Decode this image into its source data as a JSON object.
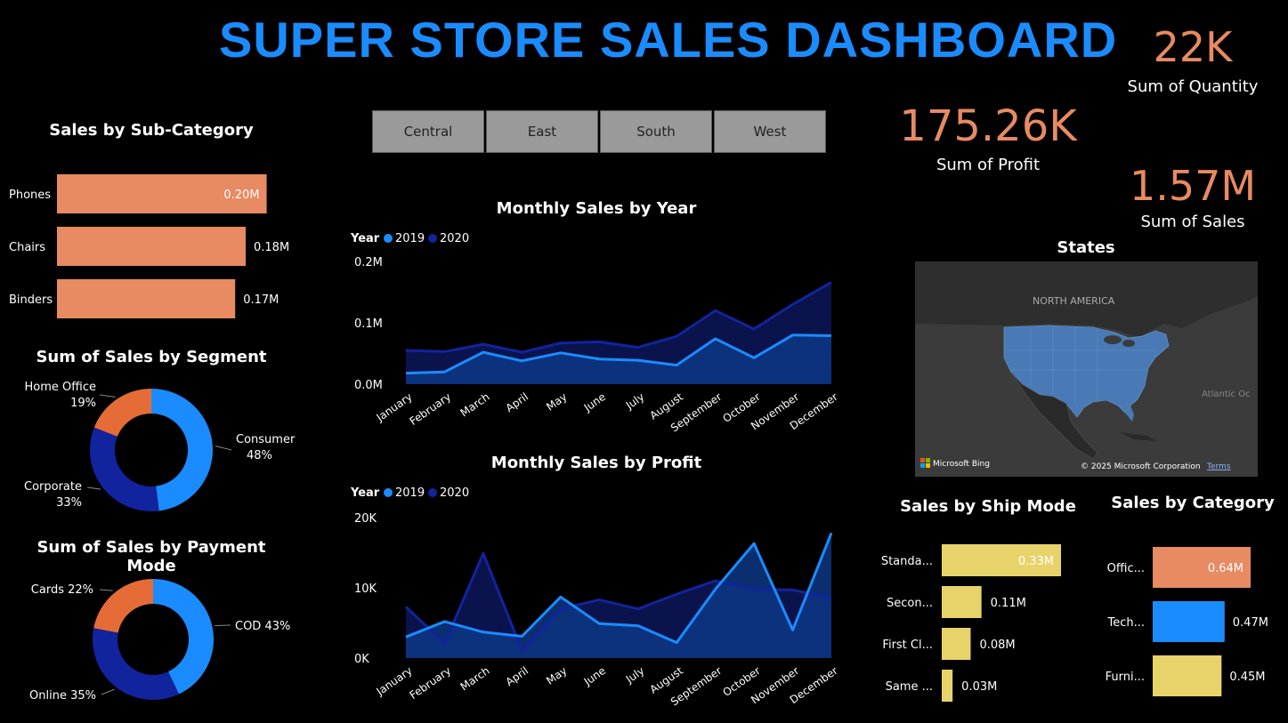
{
  "title": "SUPER STORE SALES DASHBOARD",
  "cards": {
    "quantity": {
      "value": "22K",
      "label": "Sum of Quantity"
    },
    "profit": {
      "value": "175.26K",
      "label": "Sum of Profit"
    },
    "sales": {
      "value": "1.57M",
      "label": "Sum of Sales"
    }
  },
  "slicer": {
    "regions": [
      "Central",
      "East",
      "South",
      "West"
    ]
  },
  "subcategory": {
    "title": "Sales by Sub-Category",
    "chart_data": {
      "type": "bar",
      "categories": [
        "Phones",
        "Chairs",
        "Binders"
      ],
      "values": [
        0.2,
        0.18,
        0.17
      ],
      "labels": [
        "0.20M",
        "0.18M",
        "0.17M"
      ],
      "color": "#e88a62"
    }
  },
  "segment": {
    "title": "Sum of Sales by Segment",
    "chart_data": {
      "type": "pie",
      "categories": [
        "Consumer",
        "Corporate",
        "Home Office"
      ],
      "values": [
        48,
        33,
        19
      ],
      "colors": [
        "#1a8cff",
        "#12239e",
        "#e66c37"
      ],
      "labels": [
        [
          "Consumer",
          "48%"
        ],
        [
          "Corporate",
          "33%"
        ],
        [
          "Home Office",
          "19%"
        ]
      ]
    }
  },
  "payment": {
    "title": "Sum of Sales by Payment Mode",
    "chart_data": {
      "type": "pie",
      "categories": [
        "COD",
        "Online",
        "Cards"
      ],
      "values": [
        43,
        35,
        22
      ],
      "colors": [
        "#1a8cff",
        "#12239e",
        "#e66c37"
      ],
      "labels": [
        "COD 43%",
        "Online 35%",
        "Cards 22%"
      ]
    }
  },
  "monthly_sales": {
    "title": "Monthly Sales by Year",
    "legend_title": "Year",
    "chart_data": {
      "type": "area",
      "x": [
        "January",
        "February",
        "March",
        "April",
        "May",
        "June",
        "July",
        "August",
        "September",
        "October",
        "November",
        "December"
      ],
      "series": [
        {
          "name": "2019",
          "color": "#1a8cff",
          "values": [
            0.018,
            0.02,
            0.052,
            0.038,
            0.051,
            0.041,
            0.039,
            0.031,
            0.074,
            0.043,
            0.08,
            0.079
          ]
        },
        {
          "name": "2020",
          "color": "#12239e",
          "values": [
            0.055,
            0.053,
            0.065,
            0.052,
            0.067,
            0.069,
            0.06,
            0.078,
            0.12,
            0.09,
            0.13,
            0.166
          ]
        }
      ],
      "ylim": [
        0,
        0.2
      ],
      "yticks": [
        "0.0M",
        "0.1M",
        "0.2M"
      ],
      "ytick_values": [
        0,
        0.1,
        0.2
      ]
    }
  },
  "monthly_profit": {
    "title": "Monthly Sales by Profit",
    "legend_title": "Year",
    "chart_data": {
      "type": "area",
      "x": [
        "January",
        "February",
        "March",
        "April",
        "May",
        "June",
        "July",
        "August",
        "September",
        "October",
        "November",
        "December"
      ],
      "series": [
        {
          "name": "2019",
          "color": "#1a8cff",
          "values": [
            3000,
            5200,
            3700,
            3100,
            8700,
            4900,
            4600,
            2200,
            9800,
            16300,
            4000,
            17800
          ]
        },
        {
          "name": "2020",
          "color": "#12239e",
          "values": [
            7300,
            2100,
            14900,
            1100,
            7000,
            8300,
            7000,
            9100,
            11000,
            9800,
            9700,
            8600
          ]
        }
      ],
      "ylim": [
        0,
        20000
      ],
      "yticks": [
        "0K",
        "10K",
        "20K"
      ],
      "ytick_values": [
        0,
        10000,
        20000
      ]
    }
  },
  "states": {
    "title": "States",
    "continent_label": "NORTH AMERICA",
    "ocean_label": "Atlantic Oc",
    "bing_label": "Microsoft Bing",
    "copyright": "© 2025 Microsoft Corporation",
    "terms": "Terms"
  },
  "shipmode": {
    "title": "Sales by Ship Mode",
    "chart_data": {
      "type": "bar",
      "categories": [
        "Standa...",
        "Secon...",
        "First Cl...",
        "Same ..."
      ],
      "values": [
        0.33,
        0.11,
        0.08,
        0.03
      ],
      "labels": [
        "0.33M",
        "0.11M",
        "0.08M",
        "0.03M"
      ],
      "color": "#e8d36b"
    }
  },
  "category": {
    "title": "Sales by Category",
    "chart_data": {
      "type": "bar",
      "categories": [
        "Offic...",
        "Tech...",
        "Furni..."
      ],
      "values": [
        0.64,
        0.47,
        0.45
      ],
      "labels": [
        "0.64M",
        "0.47M",
        "0.45M"
      ],
      "colors": [
        "#e88a62",
        "#1a8cff",
        "#e8d36b"
      ]
    }
  }
}
